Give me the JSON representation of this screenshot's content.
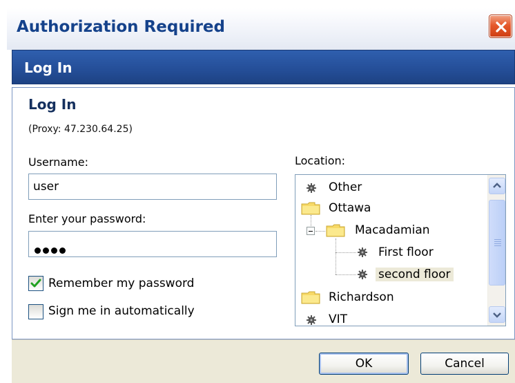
{
  "window": {
    "title": "Authorization Required"
  },
  "header": {
    "title": "Log In"
  },
  "form": {
    "section_title": "Log In",
    "proxy_text": "(Proxy: 47.230.64.25)",
    "username_label": "Username:",
    "username_value": "user",
    "password_label": "Enter your password:",
    "password_masked_length": 4,
    "remember": {
      "label": "Remember my password",
      "checked": true
    },
    "auto_signin": {
      "label": "Sign me in automatically",
      "checked": false
    }
  },
  "location": {
    "label": "Location:",
    "items": [
      {
        "label": "Other",
        "icon": "gear-icon"
      },
      {
        "label": "Ottawa",
        "icon": "folder-icon"
      },
      {
        "label": "Macadamian",
        "icon": "folder-icon",
        "expanded": true
      },
      {
        "label": "First floor",
        "icon": "gear-icon"
      },
      {
        "label": "second floor",
        "icon": "gear-icon",
        "selected": true
      },
      {
        "label": "Richardson",
        "icon": "folder-icon"
      },
      {
        "label": "VIT",
        "icon": "gear-icon"
      }
    ]
  },
  "buttons": {
    "ok": "OK",
    "cancel": "Cancel"
  },
  "colors": {
    "title_text": "#15428b",
    "header_band": "#254f99",
    "close_button": "#e6592b",
    "footer": "#ece9d8",
    "selected_item_bg": "#ece9d8"
  }
}
